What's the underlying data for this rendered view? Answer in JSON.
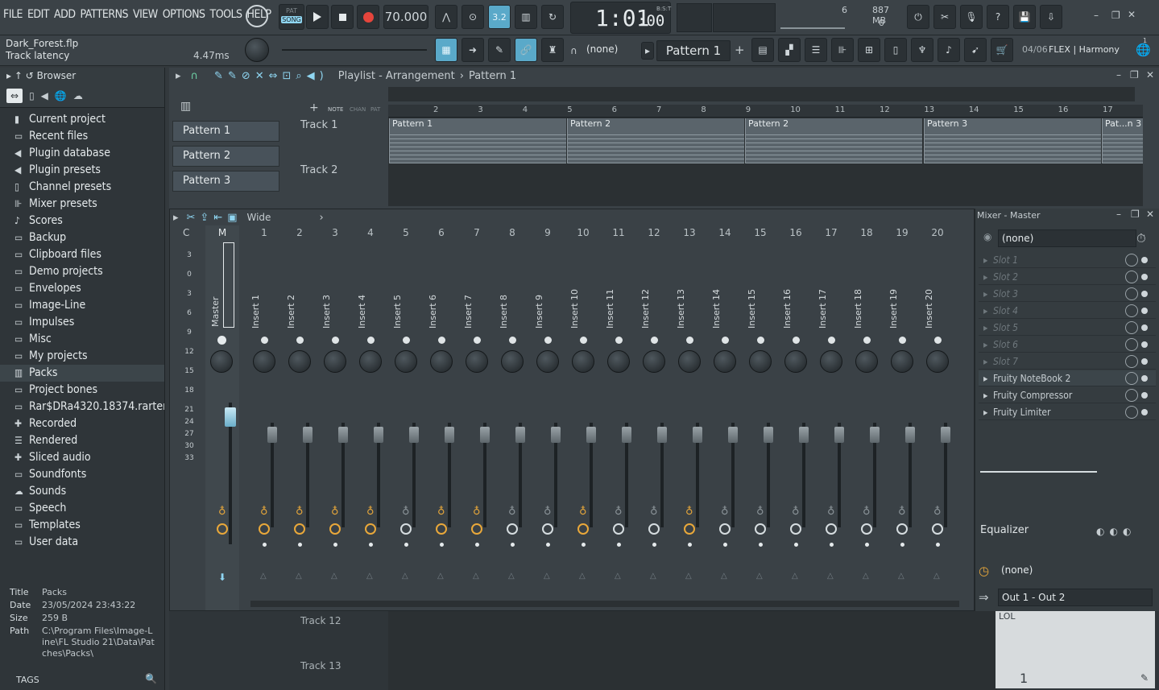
{
  "menu": [
    "FILE",
    "EDIT",
    "ADD",
    "PATTERNS",
    "VIEW",
    "OPTIONS",
    "TOOLS",
    "HELP"
  ],
  "transport": {
    "pat": "PAT",
    "song": "SONG",
    "tempo": "70.000",
    "time": "1:01",
    "time_small": ":00",
    "bst": "B:S:T"
  },
  "memory": {
    "top_num": "6",
    "mb": "887 MB",
    "second": "0"
  },
  "project": {
    "file": "Dark_Forest.flp",
    "latency_label": "Track latency",
    "latency": "4.47ms"
  },
  "toolbar2": {
    "none_label": "(none)",
    "pattern": "Pattern 1",
    "plus": "+",
    "news_date": "04/06",
    "news_text": "FLEX | Harmony",
    "badge": "1"
  },
  "browser": {
    "title": "Browser",
    "items": [
      {
        "label": "Current project",
        "icon": "project-icon"
      },
      {
        "label": "Recent files",
        "icon": "recent-icon"
      },
      {
        "label": "Plugin database",
        "icon": "plugin-icon"
      },
      {
        "label": "Plugin presets",
        "icon": "plugin-icon"
      },
      {
        "label": "Channel presets",
        "icon": "folder-icon"
      },
      {
        "label": "Mixer presets",
        "icon": "mixer-icon"
      },
      {
        "label": "Scores",
        "icon": "note-icon"
      },
      {
        "label": "Backup",
        "icon": "folder-icon"
      },
      {
        "label": "Clipboard files",
        "icon": "folder-icon"
      },
      {
        "label": "Demo projects",
        "icon": "folder-icon"
      },
      {
        "label": "Envelopes",
        "icon": "folder-icon"
      },
      {
        "label": "Image-Line",
        "icon": "folder-icon"
      },
      {
        "label": "Impulses",
        "icon": "folder-icon"
      },
      {
        "label": "Misc",
        "icon": "folder-icon"
      },
      {
        "label": "My projects",
        "icon": "folder-icon"
      },
      {
        "label": "Packs",
        "icon": "packs-icon"
      },
      {
        "label": "Project bones",
        "icon": "folder-icon"
      },
      {
        "label": "Rar$DRa4320.18374.rartemp",
        "icon": "folder-icon"
      },
      {
        "label": "Recorded",
        "icon": "recorded-icon"
      },
      {
        "label": "Rendered",
        "icon": "rendered-icon"
      },
      {
        "label": "Sliced audio",
        "icon": "sliced-icon"
      },
      {
        "label": "Soundfonts",
        "icon": "folder-icon"
      },
      {
        "label": "Sounds",
        "icon": "cloud-icon"
      },
      {
        "label": "Speech",
        "icon": "folder-icon"
      },
      {
        "label": "Templates",
        "icon": "folder-icon"
      },
      {
        "label": "User data",
        "icon": "folder-icon"
      }
    ],
    "info": {
      "title_k": "Title",
      "title": "Packs",
      "date_k": "Date",
      "date": "23/05/2024 23:43:22",
      "size_k": "Size",
      "size": "259 B",
      "path_k": "Path",
      "path": "C:\\Program Files\\Image-Line\\FL Studio 21\\Data\\Patches\\Packs\\"
    },
    "tags": "TAGS"
  },
  "playlist": {
    "title": "Playlist - Arrangement",
    "crumb": "Pattern 1",
    "patterns": [
      "Pattern 1",
      "Pattern 2",
      "Pattern 3"
    ],
    "tracks": [
      "Track 1",
      "Track 2",
      "Track 12",
      "Track 13"
    ],
    "ruler": [
      "2",
      "3",
      "4",
      "5",
      "6",
      "7",
      "8",
      "9",
      "10",
      "11",
      "12",
      "13",
      "14",
      "15",
      "16",
      "17"
    ],
    "clips": [
      "Pattern 1",
      "Pattern 2",
      "Pattern 2",
      "Pattern 3",
      "Pat...n 3"
    ],
    "tool_labels": {
      "note": "NOTE",
      "chan": "CHAN",
      "pat": "PAT"
    }
  },
  "mixer": {
    "preset": "Wide",
    "current_label": "C",
    "master_label": "M",
    "master_name": "Master",
    "scale": [
      "3",
      "0",
      "3",
      "6",
      "9",
      "12",
      "15",
      "18",
      "21",
      "24",
      "27",
      "30",
      "33"
    ],
    "inserts": [
      {
        "num": "1",
        "name": "Insert 1",
        "on": true
      },
      {
        "num": "2",
        "name": "Insert 2",
        "on": true
      },
      {
        "num": "3",
        "name": "Insert 3",
        "on": true
      },
      {
        "num": "4",
        "name": "Insert 4",
        "on": true
      },
      {
        "num": "5",
        "name": "Insert 5",
        "on": false
      },
      {
        "num": "6",
        "name": "Insert 6",
        "on": true
      },
      {
        "num": "7",
        "name": "Insert 7",
        "on": true
      },
      {
        "num": "8",
        "name": "Insert 8",
        "on": false
      },
      {
        "num": "9",
        "name": "Insert 9",
        "on": false
      },
      {
        "num": "10",
        "name": "Insert 10",
        "on": true
      },
      {
        "num": "11",
        "name": "Insert 11",
        "on": false
      },
      {
        "num": "12",
        "name": "Insert 12",
        "on": false
      },
      {
        "num": "13",
        "name": "Insert 13",
        "on": true
      },
      {
        "num": "14",
        "name": "Insert 14",
        "on": false
      },
      {
        "num": "15",
        "name": "Insert 15",
        "on": false
      },
      {
        "num": "16",
        "name": "Insert 16",
        "on": false
      },
      {
        "num": "17",
        "name": "Insert 17",
        "on": false
      },
      {
        "num": "18",
        "name": "Insert 18",
        "on": false
      },
      {
        "num": "19",
        "name": "Insert 19",
        "on": false
      },
      {
        "num": "20",
        "name": "Insert 20",
        "on": false
      }
    ]
  },
  "mixer_master": {
    "title": "Mixer - Master",
    "preset": "(none)",
    "slots": [
      "Slot 1",
      "Slot 2",
      "Slot 3",
      "Slot 4",
      "Slot 5",
      "Slot 6",
      "Slot 7",
      "Fruity NoteBook 2",
      "Fruity Compressor",
      "Fruity Limiter"
    ],
    "eq": "Equalizer",
    "input": "(none)",
    "output": "Out 1 - Out 2",
    "page": "1",
    "note_text": "LOL"
  }
}
